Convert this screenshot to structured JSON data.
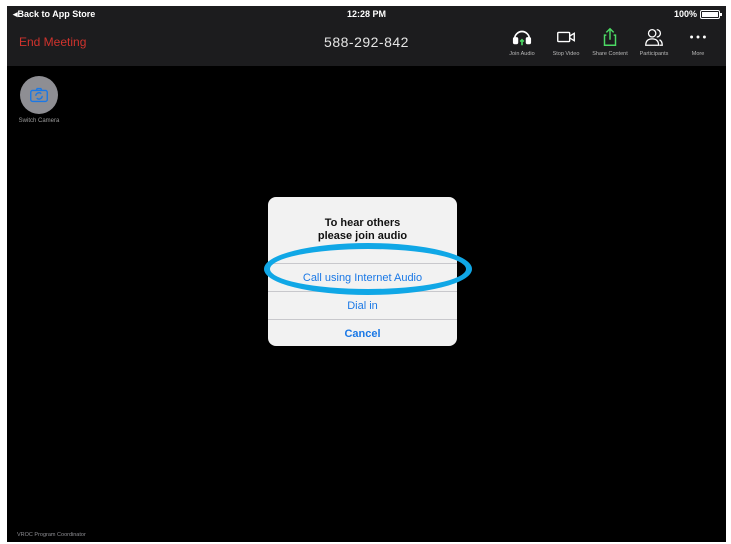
{
  "statusbar": {
    "back_label": "Back to App Store",
    "time": "12:28 PM",
    "battery": "100%"
  },
  "toolbar": {
    "end_meeting": "End Meeting",
    "meeting_id": "588-292-842",
    "tools": [
      {
        "label": "Join Audio",
        "icon": "headphones-icon"
      },
      {
        "label": "Stop Video",
        "icon": "video-camera-icon"
      },
      {
        "label": "Share Content",
        "icon": "share-icon",
        "color": "#4cd964"
      },
      {
        "label": "Participants",
        "icon": "participants-icon"
      },
      {
        "label": "More",
        "icon": "more-icon"
      }
    ]
  },
  "video": {
    "switch_camera": "Switch Camera",
    "participant_name": "VROC Program Coordinator"
  },
  "dialog": {
    "title_line1": "To hear others",
    "title_line2": "please join audio",
    "option_internet": "Call using Internet Audio",
    "option_dial": "Dial in",
    "option_cancel": "Cancel"
  },
  "colors": {
    "end_meeting": "#d0332d",
    "link": "#1a78e6",
    "highlight": "#10a7e6"
  }
}
